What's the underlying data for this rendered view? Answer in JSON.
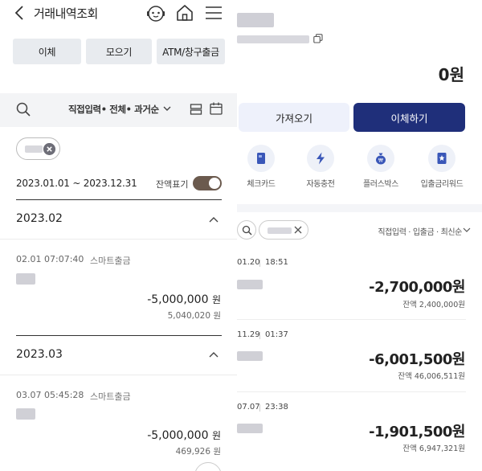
{
  "left": {
    "title": "거래내역조회",
    "buttons": [
      {
        "label": "이체"
      },
      {
        "label": "모으기"
      },
      {
        "label": "ATM/창구출금"
      }
    ],
    "filter": {
      "text": "직접입력• 전체• 과거순"
    },
    "date_range": "2023.01.01 ~ 2023.12.31",
    "balance_toggle": {
      "label": "잔액표기",
      "on": true
    },
    "sections": [
      {
        "month": "2023.02",
        "expanded": true,
        "transactions": [
          {
            "datetime": "02.01 07:07:40",
            "type": "스마트출금",
            "amount": "-5,000,000",
            "currency": "원",
            "balance": "5,040,020 원"
          }
        ]
      },
      {
        "month": "2023.03",
        "expanded": true,
        "transactions": [
          {
            "datetime": "03.07 05:45:28",
            "type": "스마트출금",
            "amount": "-5,000,000",
            "currency": "원",
            "balance": "469,926 원"
          }
        ]
      }
    ]
  },
  "right": {
    "balance": "0원",
    "buttons": {
      "import": "가져오기",
      "transfer": "이체하기"
    },
    "quick_actions": [
      {
        "label": "체크카드",
        "icon": "card-icon"
      },
      {
        "label": "자동충전",
        "icon": "bolt-icon"
      },
      {
        "label": "플러스박스",
        "icon": "money-bag-icon"
      },
      {
        "label": "입출금리워드",
        "icon": "reward-icon"
      }
    ],
    "filter": {
      "text": "직접입력 · 입출금 · 최신순"
    },
    "transactions": [
      {
        "date": "01.20",
        "time": "18:51",
        "amount": "-2,700,000원",
        "balance": "잔액 2,400,000원"
      },
      {
        "date": "11.29",
        "time": "01:37",
        "amount": "-6,001,500원",
        "balance": "잔액 46,006,511원"
      },
      {
        "date": "07.07",
        "time": "23:38",
        "amount": "-1,901,500원",
        "balance": "잔액 6,947,321원"
      }
    ]
  },
  "colors": {
    "brand_navy": "#1f2f7a",
    "light_button": "#e8ebef",
    "toggle_on": "#6b5a4e"
  }
}
